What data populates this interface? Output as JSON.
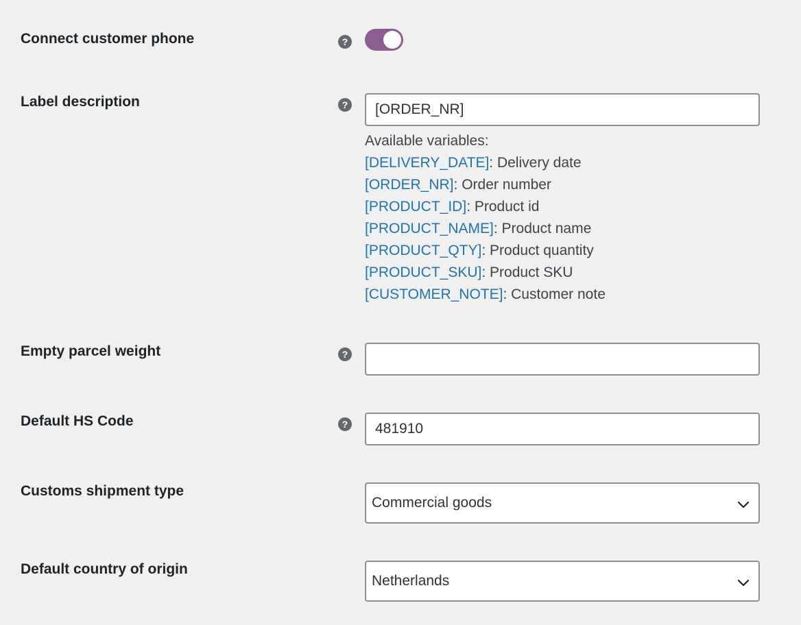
{
  "settings": {
    "connect_phone": {
      "label": "Connect customer phone",
      "enabled": true
    },
    "label_description": {
      "label": "Label description",
      "value": "[ORDER_NR]",
      "variables_heading": "Available variables:",
      "variables": [
        {
          "code": "[DELIVERY_DATE]",
          "desc": ": Delivery date"
        },
        {
          "code": "[ORDER_NR]",
          "desc": ": Order number"
        },
        {
          "code": "[PRODUCT_ID]",
          "desc": ": Product id"
        },
        {
          "code": "[PRODUCT_NAME]",
          "desc": ": Product name"
        },
        {
          "code": "[PRODUCT_QTY]",
          "desc": ": Product quantity"
        },
        {
          "code": "[PRODUCT_SKU]",
          "desc": ": Product SKU"
        },
        {
          "code": "[CUSTOMER_NOTE]",
          "desc": ": Customer note"
        }
      ]
    },
    "empty_parcel_weight": {
      "label": "Empty parcel weight",
      "value": ""
    },
    "default_hs_code": {
      "label": "Default HS Code",
      "value": "481910"
    },
    "customs_shipment_type": {
      "label": "Customs shipment type",
      "selected": "Commercial goods"
    },
    "default_country_of_origin": {
      "label": "Default country of origin",
      "selected": "Netherlands"
    }
  },
  "help_glyph": "?",
  "icons": {
    "help": "help-icon",
    "chevron": "chevron-down-icon"
  },
  "colors": {
    "toggle_on": "#8c5d8f",
    "link": "#2271b1",
    "background": "#f0f0f1"
  }
}
